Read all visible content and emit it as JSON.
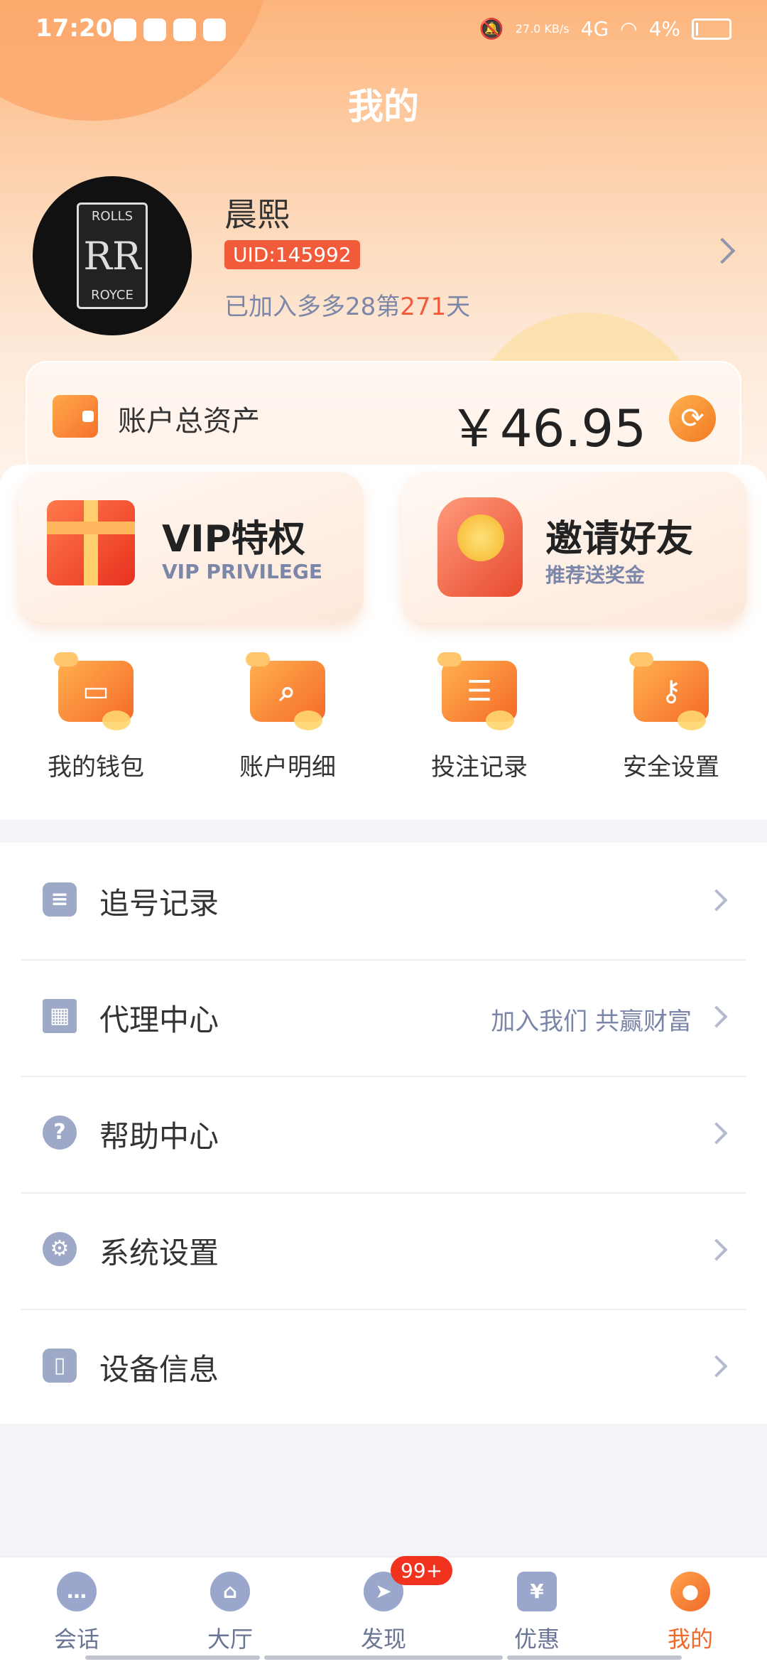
{
  "status_bar": {
    "time": "17:20",
    "speed": "27.0 KB/s",
    "network": "4G",
    "battery": "4%"
  },
  "page_title": "我的",
  "profile": {
    "name": "晨熙",
    "uid": "UID:145992",
    "joined_prefix": "已加入多多28第",
    "joined_days": "271",
    "joined_suffix": "天",
    "avatar_text_top": "ROLLS",
    "avatar_text_mid": "RR",
    "avatar_text_bottom": "ROYCE"
  },
  "asset": {
    "label": "账户总资产",
    "value": "￥46.95"
  },
  "promos": [
    {
      "title": "VIP特权",
      "subtitle": "VIP PRIVILEGE"
    },
    {
      "title": "邀请好友",
      "subtitle": "推荐送奖金"
    }
  ],
  "quick_actions": [
    {
      "label": "我的钱包",
      "icon": "wallet-icon"
    },
    {
      "label": "账户明细",
      "icon": "search-icon"
    },
    {
      "label": "投注记录",
      "icon": "clipboard-icon"
    },
    {
      "label": "安全设置",
      "icon": "key-icon"
    }
  ],
  "menu": [
    {
      "label": "追号记录",
      "hint": "",
      "icon": "document-icon"
    },
    {
      "label": "代理中心",
      "hint": "加入我们 共赢财富",
      "icon": "qr-code-icon"
    },
    {
      "label": "帮助中心",
      "hint": "",
      "icon": "question-icon"
    },
    {
      "label": "系统设置",
      "hint": "",
      "icon": "gear-icon"
    },
    {
      "label": "设备信息",
      "hint": "",
      "icon": "tablet-icon"
    }
  ],
  "nav": [
    {
      "label": "会话",
      "icon": "chat-icon"
    },
    {
      "label": "大厅",
      "icon": "bank-icon"
    },
    {
      "label": "发现",
      "icon": "compass-icon",
      "badge": "99+"
    },
    {
      "label": "优惠",
      "icon": "coupon-icon"
    },
    {
      "label": "我的",
      "icon": "user-icon"
    }
  ],
  "colors": {
    "accent": "#f0692a",
    "badge_red": "#f25b3a",
    "muted": "#7b86a8"
  }
}
